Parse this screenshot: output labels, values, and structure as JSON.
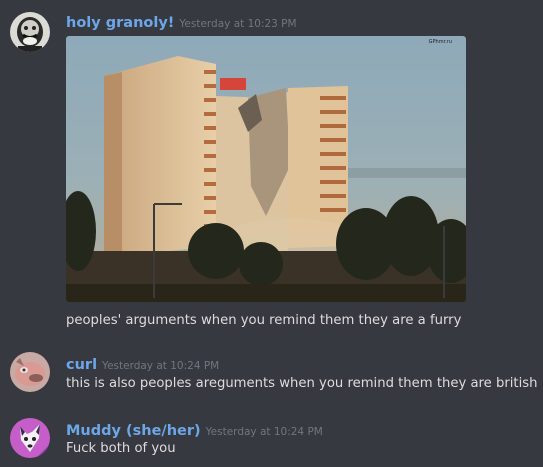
{
  "messages": [
    {
      "username": "holy granoly!",
      "timestamp": "Yesterday at 10:23 PM",
      "text": "peoples' arguments when you remind them they are a furry",
      "avatar_icon": "bearded-man-portrait-icon",
      "attachment": {
        "type": "image",
        "subject": "building-demolition-photo",
        "watermark": "GPhmr.ru"
      }
    },
    {
      "username": "curl",
      "timestamp": "Yesterday at 10:24 PM",
      "text": "this is also peoples areguments when you remind them they are british",
      "avatar_icon": "pink-creature-avatar-icon"
    },
    {
      "username": "Muddy (she/her)",
      "timestamp": "Yesterday at 10:24 PM",
      "text": "Fuck both of you",
      "avatar_icon": "fox-character-avatar-icon"
    }
  ],
  "colors": {
    "background": "#36393f",
    "username": "#6ea6e8",
    "timestamp": "#72767d",
    "text": "#dcddde"
  }
}
